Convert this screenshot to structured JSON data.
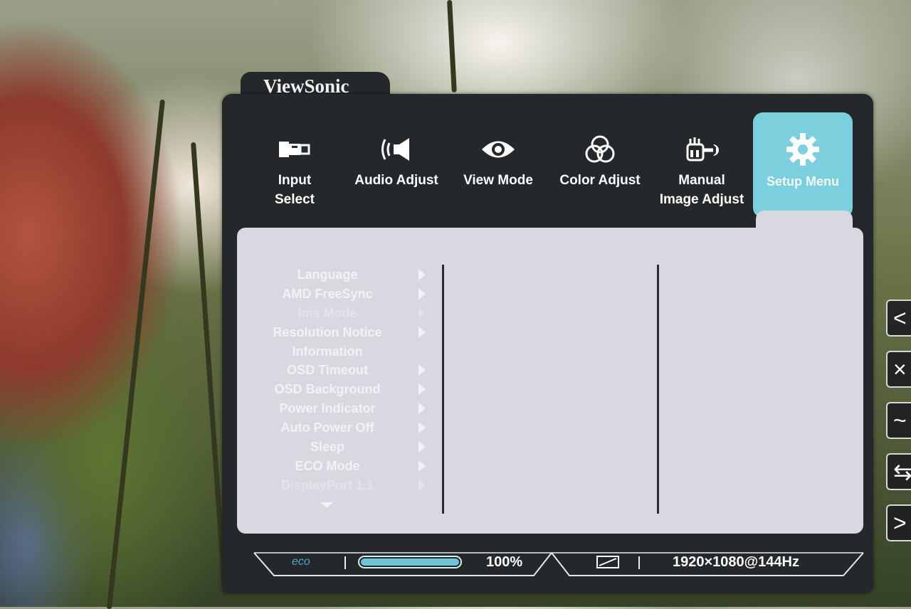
{
  "brand": "ViewSonic",
  "tabs": [
    {
      "label_line1": "Input",
      "label_line2": "Select",
      "icon": "input-connector-icon",
      "active": false
    },
    {
      "label_line1": "Audio Adjust",
      "label_line2": "",
      "icon": "speaker-icon",
      "active": false
    },
    {
      "label_line1": "View Mode",
      "label_line2": "",
      "icon": "eye-icon",
      "active": false
    },
    {
      "label_line1": "Color Adjust",
      "label_line2": "",
      "icon": "rgb-circles-icon",
      "active": false
    },
    {
      "label_line1": "Manual",
      "label_line2": "Image Adjust",
      "icon": "hand-wrench-icon",
      "active": false
    },
    {
      "label_line1": "Setup Menu",
      "label_line2": "",
      "icon": "gear-icon",
      "active": true
    }
  ],
  "menu": [
    {
      "label": "Language",
      "has_arrow": true,
      "dim": false
    },
    {
      "label": "AMD FreeSync",
      "has_arrow": true,
      "dim": false
    },
    {
      "label": "Ims Mode",
      "has_arrow": true,
      "dim": true
    },
    {
      "label": "Resolution Notice",
      "has_arrow": true,
      "dim": false
    },
    {
      "label": "Information",
      "has_arrow": false,
      "dim": false
    },
    {
      "label": "OSD Timeout",
      "has_arrow": true,
      "dim": false
    },
    {
      "label": "OSD Background",
      "has_arrow": true,
      "dim": false
    },
    {
      "label": "Power Indicator",
      "has_arrow": true,
      "dim": false
    },
    {
      "label": "Auto Power Off",
      "has_arrow": true,
      "dim": false
    },
    {
      "label": "Sleep",
      "has_arrow": true,
      "dim": false
    },
    {
      "label": "ECO Mode",
      "has_arrow": true,
      "dim": false
    },
    {
      "label": "DisplayPort 1.1",
      "has_arrow": true,
      "dim": true
    }
  ],
  "status": {
    "eco_label": "eco",
    "brightness_percent": 100,
    "brightness_text": "100%",
    "resolution": "1920×1080@144Hz"
  },
  "side_buttons": [
    "<",
    "×",
    "~",
    "⇆",
    ">"
  ],
  "colors": {
    "accent": "#7ccfdc",
    "panel_bg": "#d8d8e0",
    "osd_bg": "#25282a",
    "eco_blue": "#4fa3d0"
  }
}
